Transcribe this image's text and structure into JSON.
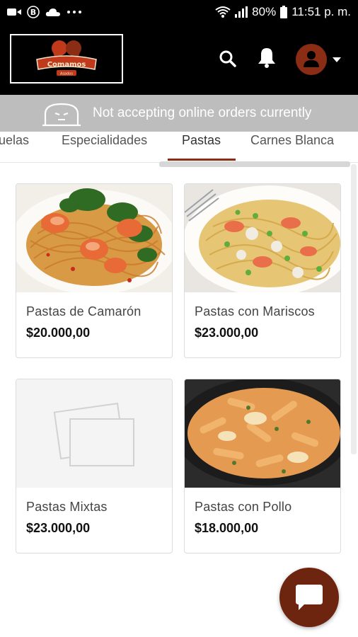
{
  "status_bar": {
    "battery": "80%",
    "time": "11:51 p. m.",
    "left_icons": [
      "video-icon",
      "b-badge-icon",
      "cloud-icon",
      "more-dots-icon"
    ],
    "right_icons": [
      "wifi-icon",
      "signal-icon",
      "battery-icon"
    ]
  },
  "header": {
    "logo_alt": "Comamos",
    "logo_subtext": "Asados",
    "icons": [
      "search-icon",
      "bell-icon",
      "account-icon",
      "chevron-down-icon"
    ],
    "brand_color": "#8b2c14"
  },
  "banner": {
    "text": "Not accepting online orders currently",
    "icon": "closed-sign-icon"
  },
  "tabs": [
    {
      "label": "uelas"
    },
    {
      "label": "Especialidades"
    },
    {
      "label": "Pastas",
      "active": true
    },
    {
      "label": "Carnes Blanca"
    }
  ],
  "products": [
    {
      "name": "Pastas de Camarón",
      "price": "$20.000,00",
      "image": "shrimp-pasta-photo"
    },
    {
      "name": "Pastas con Mariscos",
      "price": "$23.000,00",
      "image": "seafood-pasta-photo"
    },
    {
      "name": "Pastas Mixtas",
      "price": "$23.000,00",
      "image": "placeholder-image-icon"
    },
    {
      "name": "Pastas con Pollo",
      "price": "$18.000,00",
      "image": "chicken-pasta-photo"
    }
  ],
  "chat_button": {
    "icon": "chat-bubble-icon",
    "color": "#6e2510"
  }
}
